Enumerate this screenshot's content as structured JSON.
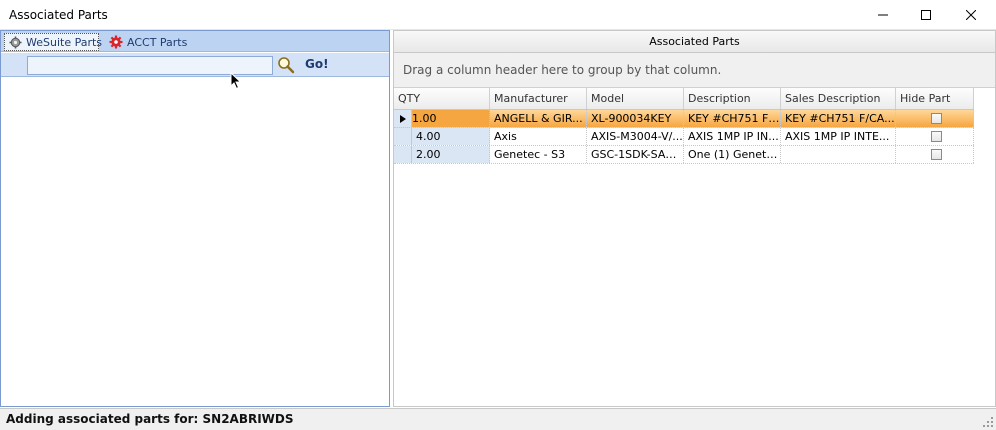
{
  "window": {
    "title": "Associated Parts"
  },
  "left_panel": {
    "tabs": [
      {
        "label": "WeSuite Parts",
        "icon": "gear-icon",
        "active": true
      },
      {
        "label": "ACCT Parts",
        "icon": "red-gear-icon",
        "active": false
      }
    ],
    "search": {
      "value": "",
      "placeholder": ""
    },
    "go_label": "Go!"
  },
  "right_panel": {
    "title": "Associated Parts",
    "group_hint": "Drag a column header here to group by that column.",
    "columns": [
      "QTY",
      "Manufacturer",
      "Model",
      "Description",
      "Sales Description",
      "Hide Part"
    ],
    "rows": [
      {
        "qty": "1.00",
        "manufacturer": "ANGELL & GIR...",
        "model": "XL-900034KEY",
        "description": "KEY #CH751 F/...",
        "sales_description": "KEY #CH751 F/CA...",
        "hide_part": false,
        "selected": true
      },
      {
        "qty": "4.00",
        "manufacturer": "Axis",
        "model": "AXIS-M3004-V/...",
        "description": "AXIS 1MP IP IN...",
        "sales_description": "AXIS 1MP IP INTE...",
        "hide_part": false,
        "selected": false
      },
      {
        "qty": "2.00",
        "manufacturer": "Genetec - S3",
        "model": "GSC-1SDK-SAN...",
        "description": "One (1) Genete...",
        "sales_description": "",
        "hide_part": false,
        "selected": false
      }
    ]
  },
  "status": {
    "text": "Adding associated parts for: SN2ABRIWDS"
  },
  "colors": {
    "selected_row": "#f6a640",
    "tab_strip": "#bcd4f2",
    "link_text": "#1f3b70"
  }
}
